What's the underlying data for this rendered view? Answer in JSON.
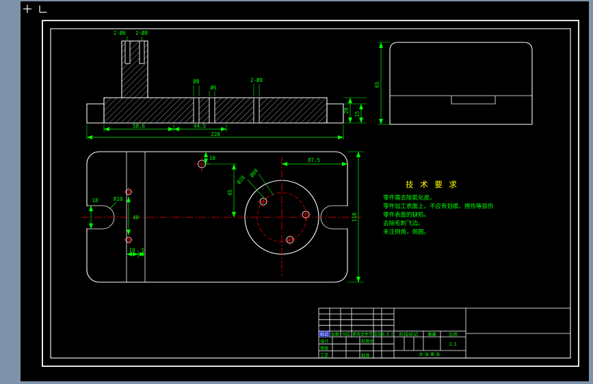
{
  "window": {
    "frame_color": "#7e93a9",
    "canvas_color": "#000000"
  },
  "colors": {
    "geometry": "#ffffff",
    "dimension": "#00ff00",
    "centerline": "#ff0000",
    "heading": "#ffff00",
    "highlight": "#2233cc"
  },
  "front_view": {
    "labels": {
      "top_left_hole": "2-Ø6",
      "top_right_hole": "2-Ø8",
      "hole_a": "Ø8",
      "hole_b": "Ø6",
      "hole_c": "2-Ø8",
      "width_a": "58.6",
      "width_b": "44.5",
      "width_total": "220",
      "thickness": "20",
      "step": "15"
    }
  },
  "side_view": {
    "labels": {
      "height": "65"
    }
  },
  "plan_view": {
    "labels": {
      "edge_offset": "10",
      "center_offset": "45",
      "right_offset": "87.5",
      "plate_height": "110",
      "slot_width": "18",
      "slot_radius": "R10",
      "bore": "Ø28",
      "bolt_circle": "Ø88",
      "hole_spacing": "40",
      "bottom_a": "10",
      "bottom_b": "5"
    }
  },
  "tech_req": {
    "title": "技 术 要 求",
    "lines": [
      "零件需去除氧化皮。",
      "零件加工表面上，不应有划痕、擦伤等损伤",
      "零件表面的缺陷。",
      "去除毛刺飞边。",
      "未注倒角，倒圆。"
    ]
  },
  "title_block": {
    "mark": "标记",
    "count": "处数",
    "zone": "分区",
    "change_no": "更改文件号",
    "sign": "签名",
    "date": "年、月、日",
    "design": "设计",
    "check": "审核",
    "process": "工艺",
    "standard": "标准化",
    "approve": "批准",
    "stage": "阶段标记",
    "weight": "重量",
    "scale": "比例",
    "scale_value": "1:1",
    "sheet": "共 张 第 张"
  }
}
